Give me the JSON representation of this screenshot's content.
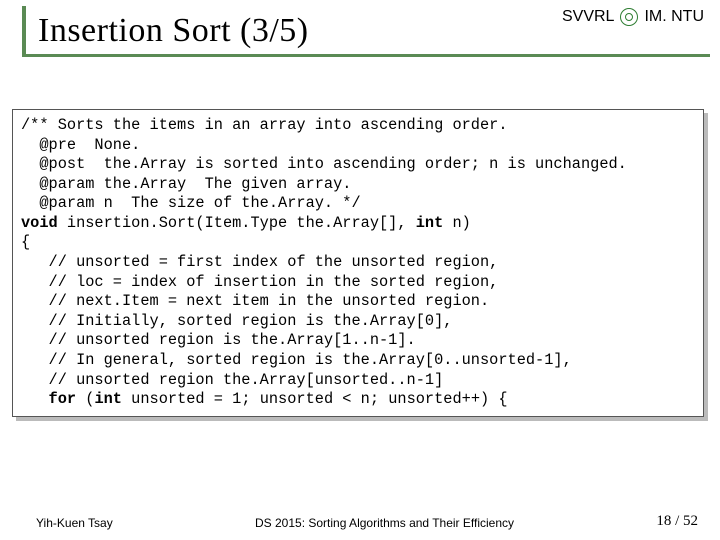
{
  "header": {
    "lab": "SVVRL",
    "at": "@",
    "org": "IM. NTU",
    "title": "Insertion Sort (3/5)"
  },
  "code": {
    "l1": "/** Sorts the items in an array into ascending order.",
    "l2": "  @pre  None.",
    "l3": "  @post  the.Array is sorted into ascending order; n is unchanged.",
    "l4": "  @param the.Array  The given array.",
    "l5": "  @param n  The size of the.Array. */",
    "l6a": "void",
    "l6b": " insertion.Sort(Item.Type the.Array[], ",
    "l6c": "int",
    "l6d": " n)",
    "l7": "{",
    "l8": "   // unsorted = first index of the unsorted region,",
    "l9": "   // loc = index of insertion in the sorted region,",
    "l10": "   // next.Item = next item in the unsorted region.",
    "l11": "   // Initially, sorted region is the.Array[0],",
    "l12": "   // unsorted region is the.Array[1..n-1].",
    "l13": "   // In general, sorted region is the.Array[0..unsorted-1],",
    "l14": "   // unsorted region the.Array[unsorted..n-1]",
    "l15a": "   ",
    "l15b": "for",
    "l15c": " (",
    "l15d": "int",
    "l15e": " unsorted = 1; unsorted < n; unsorted++) {"
  },
  "footer": {
    "author": "Yih-Kuen Tsay",
    "course": "DS 2015: Sorting Algorithms and Their Efficiency",
    "page": "18 / 52"
  }
}
